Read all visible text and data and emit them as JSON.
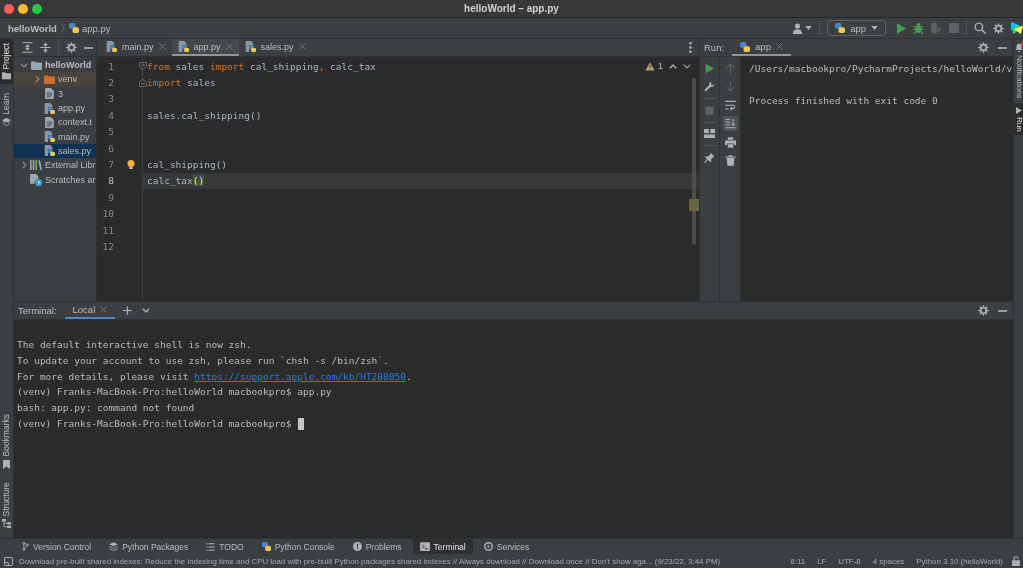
{
  "window": {
    "title": "helloWorld – app.py"
  },
  "navbar": {
    "breadcrumbs": [
      {
        "label": "helloWorld",
        "kind": "project"
      },
      {
        "label": "app.py",
        "kind": "python"
      }
    ],
    "toolbar": [
      {
        "kind": "account",
        "disabled": false
      },
      {
        "kind": "run_config",
        "label": "app",
        "disabled": false
      },
      {
        "kind": "run",
        "disabled": false
      },
      {
        "kind": "debug",
        "disabled": false
      },
      {
        "kind": "coverage",
        "disabled": true
      },
      {
        "kind": "stop",
        "disabled": true
      },
      {
        "kind": "search",
        "disabled": false
      },
      {
        "kind": "settings",
        "disabled": false
      },
      {
        "kind": "logo"
      }
    ]
  },
  "left_strip": {
    "top": [
      {
        "label": "Project",
        "kind": "project",
        "selected": true
      },
      {
        "label": "Learn",
        "kind": "learn",
        "selected": false
      }
    ],
    "bottom": [
      {
        "label": "Bookmarks",
        "kind": "bookmarks",
        "selected": false
      },
      {
        "label": "Structure",
        "kind": "structure",
        "selected": false
      }
    ]
  },
  "tree": [
    {
      "label": "helloWorld",
      "kind": "project",
      "expanded": true,
      "selected": false,
      "hovered": false,
      "children": [
        {
          "label": "venv",
          "kind": "excluded_folder",
          "expanded": false,
          "selected": false,
          "hovered": true
        },
        {
          "label": "3",
          "kind": "text_file",
          "selected": false,
          "hovered": false
        },
        {
          "label": "app.py",
          "kind": "python_file",
          "selected": false,
          "hovered": false
        },
        {
          "label": "context.t",
          "kind": "text_file",
          "selected": false,
          "hovered": false
        },
        {
          "label": "main.py",
          "kind": "python_file",
          "selected": false,
          "hovered": false
        },
        {
          "label": "sales.py",
          "kind": "python_file",
          "selected": true,
          "hovered": false
        }
      ]
    },
    {
      "label": "External Libr",
      "kind": "library",
      "expanded": false,
      "selected": false,
      "hovered": false
    },
    {
      "label": "Scratches ar",
      "kind": "scratches",
      "selected": false,
      "hovered": false
    }
  ],
  "editor": {
    "tabs": [
      {
        "label": "main.py",
        "selected": false
      },
      {
        "label": "app.py",
        "selected": true
      },
      {
        "label": "sales.py",
        "selected": false
      }
    ],
    "warnings": "1",
    "lines": [
      {
        "number": "1",
        "kind": "fold_start",
        "current": false,
        "tokens": [
          {
            "text": "from",
            "kind": "keyword"
          },
          {
            "text": " sales ",
            "kind": "plain"
          },
          {
            "text": "import",
            "kind": "keyword"
          },
          {
            "text": " cal_shipping",
            "kind": "plain"
          },
          {
            "text": ",",
            "kind": "punct"
          },
          {
            "text": " calc_tax",
            "kind": "plain"
          }
        ]
      },
      {
        "number": "2",
        "kind": "fold_end",
        "current": false,
        "tokens": [
          {
            "text": "import",
            "kind": "keyword"
          },
          {
            "text": " sales",
            "kind": "plain"
          }
        ]
      },
      {
        "number": "3",
        "kind": "plain",
        "current": false
      },
      {
        "number": "4",
        "kind": "plain",
        "current": false,
        "tokens": [
          {
            "text": "sales.cal_shipping()",
            "kind": "plain"
          }
        ]
      },
      {
        "number": "5",
        "kind": "plain",
        "current": false
      },
      {
        "number": "6",
        "kind": "plain",
        "current": false
      },
      {
        "number": "7",
        "kind": "plain",
        "current": false,
        "bulb": true,
        "tokens": [
          {
            "text": "cal_shipping()",
            "kind": "plain"
          }
        ]
      },
      {
        "number": "8",
        "kind": "plain",
        "current": true,
        "tokens": [
          {
            "text": "calc_tax",
            "kind": "plain"
          },
          {
            "text": "()",
            "kind": "matched_brace"
          }
        ]
      },
      {
        "number": "9",
        "kind": "plain",
        "current": false
      },
      {
        "number": "10",
        "kind": "plain",
        "current": false
      },
      {
        "number": "11",
        "kind": "plain",
        "current": false
      },
      {
        "number": "12",
        "kind": "plain",
        "current": false
      }
    ]
  },
  "run": {
    "title": "Run:",
    "tabs": [
      {
        "label": "app",
        "selected": true
      }
    ],
    "toolbar_left": [
      [
        {
          "kind": "rerun",
          "disabled": false
        },
        {
          "kind": "modify",
          "disabled": false
        }
      ],
      [
        {
          "kind": "stop",
          "disabled": true
        }
      ],
      [
        {
          "kind": "layout",
          "disabled": false
        }
      ],
      [
        {
          "kind": "pin",
          "disabled": false
        }
      ]
    ],
    "toolbar_right": [
      {
        "kind": "up",
        "disabled": true,
        "on": false
      },
      {
        "kind": "down",
        "disabled": true,
        "on": false
      },
      {
        "kind": "wrap",
        "disabled": false,
        "on": false
      },
      {
        "kind": "scroll_end",
        "disabled": false,
        "on": true
      },
      {
        "kind": "print",
        "disabled": false,
        "on": false
      },
      {
        "kind": "clear",
        "disabled": false,
        "on": false
      }
    ],
    "output": [
      {
        "text": "/Users/macbookpro/PycharmProjects/helloWorld/v",
        "kind": "command"
      },
      {
        "text": "Process finished with exit code 0",
        "kind": "result"
      }
    ]
  },
  "right_strip": [
    {
      "label": "Notifications",
      "kind": "notifications",
      "selected": false
    },
    {
      "label": "Run",
      "kind": "run",
      "selected": true
    }
  ],
  "terminal": {
    "title": "Terminal:",
    "tabs": [
      {
        "label": "Local",
        "selected": true
      }
    ],
    "cursor": true,
    "lines": [
      [
        {
          "text": "The default interactive shell is now zsh.",
          "kind": "plain"
        }
      ],
      [
        {
          "text": "To update your account to use zsh, please run `chsh -s /bin/zsh`.",
          "kind": "plain"
        }
      ],
      [
        {
          "text": "For more details, please visit ",
          "kind": "plain"
        },
        {
          "text": "https://support.apple.com/kb/HT208050",
          "kind": "link"
        },
        {
          "text": ".",
          "kind": "plain"
        }
      ],
      [
        {
          "text": "(venv) Franks-MacBook-Pro:helloWorld macbookpro$ app.py",
          "kind": "plain"
        }
      ],
      [
        {
          "text": "bash: app.py: command not found",
          "kind": "plain"
        }
      ],
      [
        {
          "text": "(venv) Franks-MacBook-Pro:helloWorld macbookpro$",
          "kind": "plain"
        }
      ]
    ]
  },
  "tool_windows": [
    {
      "label": "Version Control",
      "kind": "vcs",
      "selected": false
    },
    {
      "label": "Python Packages",
      "kind": "packages",
      "selected": false
    },
    {
      "label": "TODO",
      "kind": "todo",
      "selected": false
    },
    {
      "label": "Python Console",
      "kind": "console",
      "selected": false
    },
    {
      "label": "Problems",
      "kind": "problems",
      "selected": false
    },
    {
      "label": "Terminal",
      "kind": "terminal",
      "selected": true
    },
    {
      "label": "Services",
      "kind": "services",
      "selected": false
    }
  ],
  "status_bar": {
    "message": "Download pre-built shared indexes: Reduce the indexing time and CPU load with pre-built Python packages shared indexes // Always download // Download once // Don't show aga... (9/23/22, 3:44 PM)",
    "items": [
      "8:11",
      "LF",
      "UTF-8",
      "4 spaces",
      "Python 3.10 (helloWorld)"
    ]
  }
}
